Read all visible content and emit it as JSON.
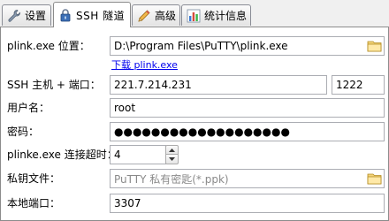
{
  "tabs": [
    {
      "label": "设置",
      "icon": "wrench-icon",
      "active": false
    },
    {
      "label": "SSH 隧道",
      "icon": "lock-icon",
      "active": true
    },
    {
      "label": "高级",
      "icon": "pencil-icon",
      "active": false
    },
    {
      "label": "统计信息",
      "icon": "bar-chart-icon",
      "active": false
    }
  ],
  "form": {
    "plink_path_label": "plink.exe 位置：",
    "plink_path_value": "D:\\Program Files\\PuTTY\\plink.exe",
    "download_link": "下载 plink.exe",
    "ssh_host_label": "SSH 主机 + 端口：",
    "ssh_host_value": "221.7.214.231",
    "ssh_port_value": "1222",
    "username_label": "用户名：",
    "username_value": "root",
    "password_label": "密码：",
    "password_value": "●●●●●●●●●●●●●●●●●●●",
    "timeout_label": "plinke.exe 连接超时：",
    "timeout_value": "4",
    "private_key_label": "私钥文件：",
    "private_key_placeholder": "PuTTY 私有密匙(*.ppk)",
    "local_port_label": "本地端口：",
    "local_port_value": "3307"
  },
  "colors": {
    "link": "#0000ee",
    "field_border": "#abadb3",
    "panel_bg": "#ffffff",
    "window_bg": "#f0f0f0"
  }
}
